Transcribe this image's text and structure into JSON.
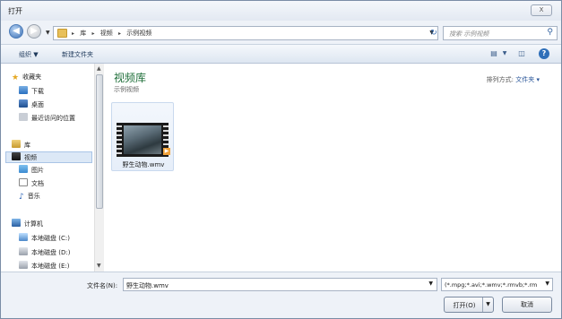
{
  "window": {
    "title": "打开",
    "close_label": "X"
  },
  "address": {
    "breadcrumbs": [
      "库",
      "视频",
      "示例视频"
    ],
    "search_placeholder": "搜索 示例视频"
  },
  "toolbar": {
    "organize_label": "组织 ▼",
    "new_folder_label": "新建文件夹"
  },
  "sidebar": {
    "favorites_label": "收藏夹",
    "favorites": [
      "下载",
      "桌面",
      "最近访问的位置"
    ],
    "libraries_label": "库",
    "libraries": [
      "视频",
      "图片",
      "文档",
      "音乐"
    ],
    "computer_label": "计算机",
    "drives": [
      "本地磁盘 (C:)",
      "本地磁盘 (D:)",
      "本地磁盘 (E:)"
    ]
  },
  "content": {
    "library_title": "视频库",
    "library_subtitle": "示例视频",
    "arrange_label": "排列方式:",
    "arrange_value": "文件夹 ▾",
    "files": [
      {
        "name": "野生动物.wmv"
      }
    ]
  },
  "bottom": {
    "filename_label": "文件名(N):",
    "filename_value": "野生动物.wmv",
    "filter_value": "(*.mpg;*.avi;*.wmv;*.rmvb;*.rm",
    "open_label": "打开(O)",
    "cancel_label": "取消"
  },
  "colors": {
    "library_title": "#1f6f3a",
    "accent": "#2f6fb9"
  }
}
